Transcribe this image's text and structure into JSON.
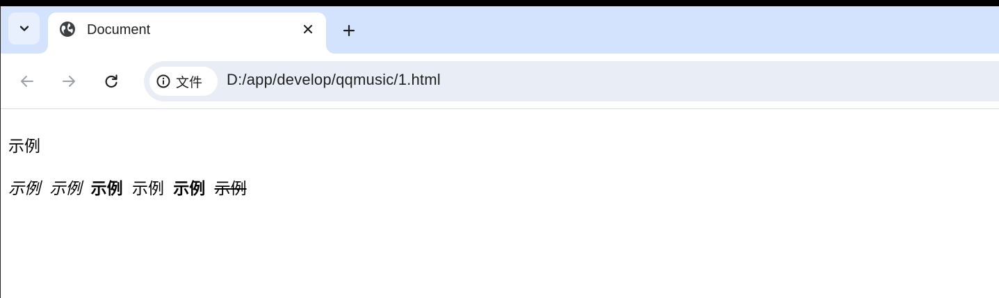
{
  "browser": {
    "tab": {
      "title": "Document"
    },
    "new_tab_label": "+",
    "close_label": "×",
    "address_bar": {
      "chip_label": "文件",
      "url": "D:/app/develop/qqmusic/1.html"
    }
  },
  "page": {
    "line1": "示例",
    "line2": [
      {
        "text": "示例",
        "style": "italic"
      },
      {
        "text": "示例",
        "style": "italic"
      },
      {
        "text": "示例",
        "style": "bold"
      },
      {
        "text": "示例",
        "style": "normal"
      },
      {
        "text": "示例",
        "style": "bold"
      },
      {
        "text": "示例",
        "style": "strikethrough"
      }
    ]
  },
  "colors": {
    "tabstrip": "#d3e3fd",
    "omnibox": "#e9eef6",
    "text": "#1f1f1f"
  }
}
